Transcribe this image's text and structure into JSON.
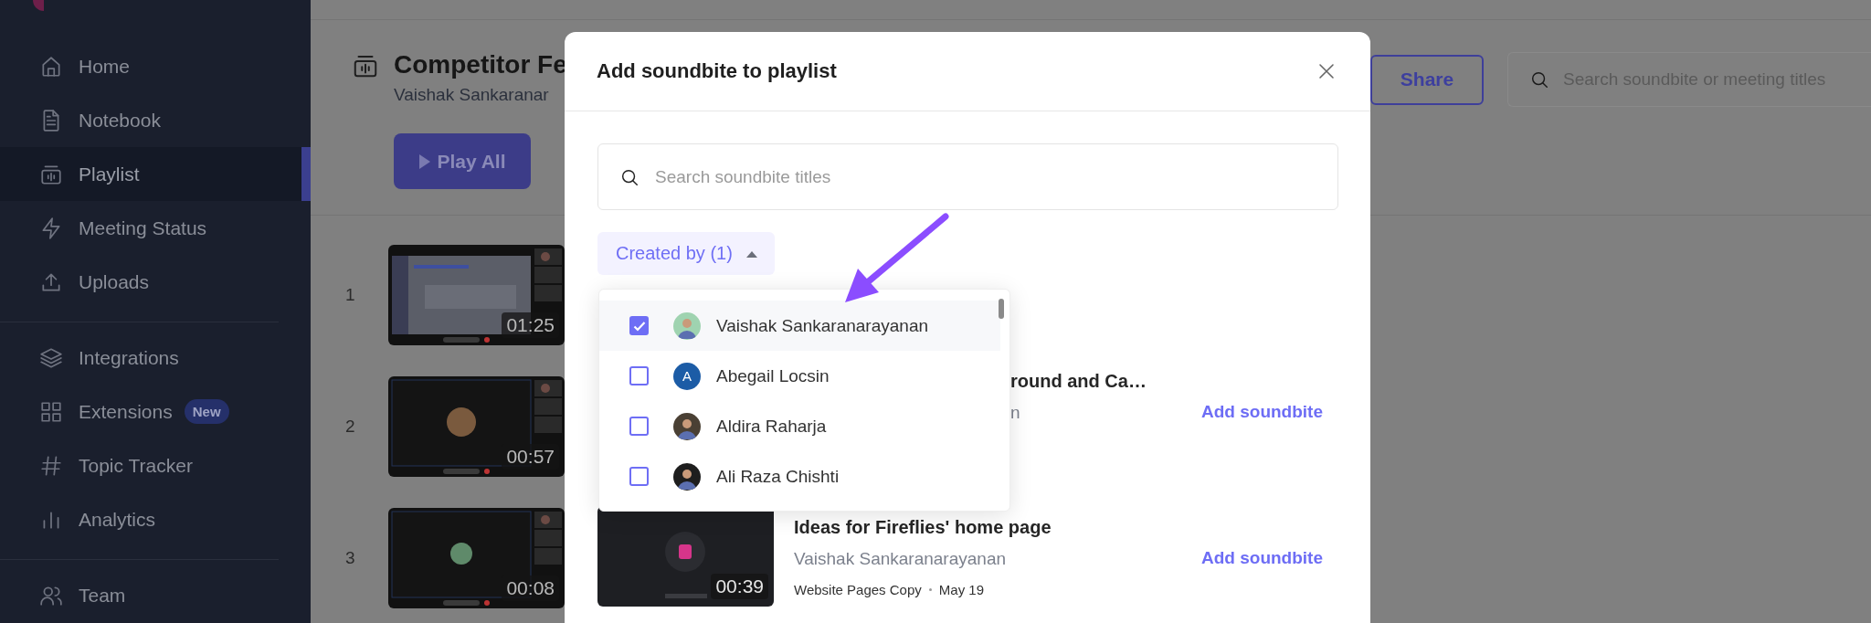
{
  "sidebar": {
    "sections": [
      {
        "items": [
          {
            "label": "Home",
            "selected": false
          },
          {
            "label": "Notebook",
            "selected": false
          },
          {
            "label": "Playlist",
            "selected": true
          },
          {
            "label": "Meeting Status",
            "selected": false
          },
          {
            "label": "Uploads",
            "selected": false
          }
        ]
      },
      {
        "items": [
          {
            "label": "Integrations",
            "selected": false
          },
          {
            "label": "Extensions",
            "selected": false,
            "badge": "New"
          },
          {
            "label": "Topic Tracker",
            "selected": false
          },
          {
            "label": "Analytics",
            "selected": false
          }
        ]
      },
      {
        "items": [
          {
            "label": "Team",
            "selected": false
          }
        ]
      }
    ]
  },
  "page": {
    "title": "Competitor Fe",
    "owner": "Vaishak Sankaranar",
    "play_button": "Play All",
    "share_button": "Share",
    "search": {
      "placeholder": "Search soundbite or meeting titles"
    },
    "soundbites": [
      {
        "number": "1",
        "duration": "01:25"
      },
      {
        "number": "2",
        "duration": "00:57"
      },
      {
        "number": "3",
        "duration": "00:08"
      }
    ]
  },
  "modal": {
    "title": "Add soundbite to playlist",
    "search": {
      "placeholder": "Search soundbite titles"
    },
    "filter": {
      "label": "Created by (1)",
      "expanded": true
    },
    "creators": [
      {
        "name": "Vaishak Sankaranarayanan",
        "selected": true,
        "checked": true
      },
      {
        "name": "Abegail Locsin",
        "selected": false,
        "checked": false,
        "avatar": {
          "kind": "initial",
          "initial": "A",
          "color": "#1c5ca6"
        }
      },
      {
        "name": "Aldira Raharja",
        "selected": false,
        "checked": false
      },
      {
        "name": "Ali Raza Chishti",
        "selected": false,
        "checked": false
      }
    ],
    "results": [
      {
        "title": "round and Ca…",
        "creator": "n",
        "action": "Add soundbite"
      },
      {
        "title": "Ideas for Fireflies' home page",
        "creator": "Vaishak Sankaranarayanan",
        "folder": "Website Pages Copy",
        "date": "May 19",
        "duration": "00:39",
        "action": "Add soundbite"
      }
    ]
  }
}
